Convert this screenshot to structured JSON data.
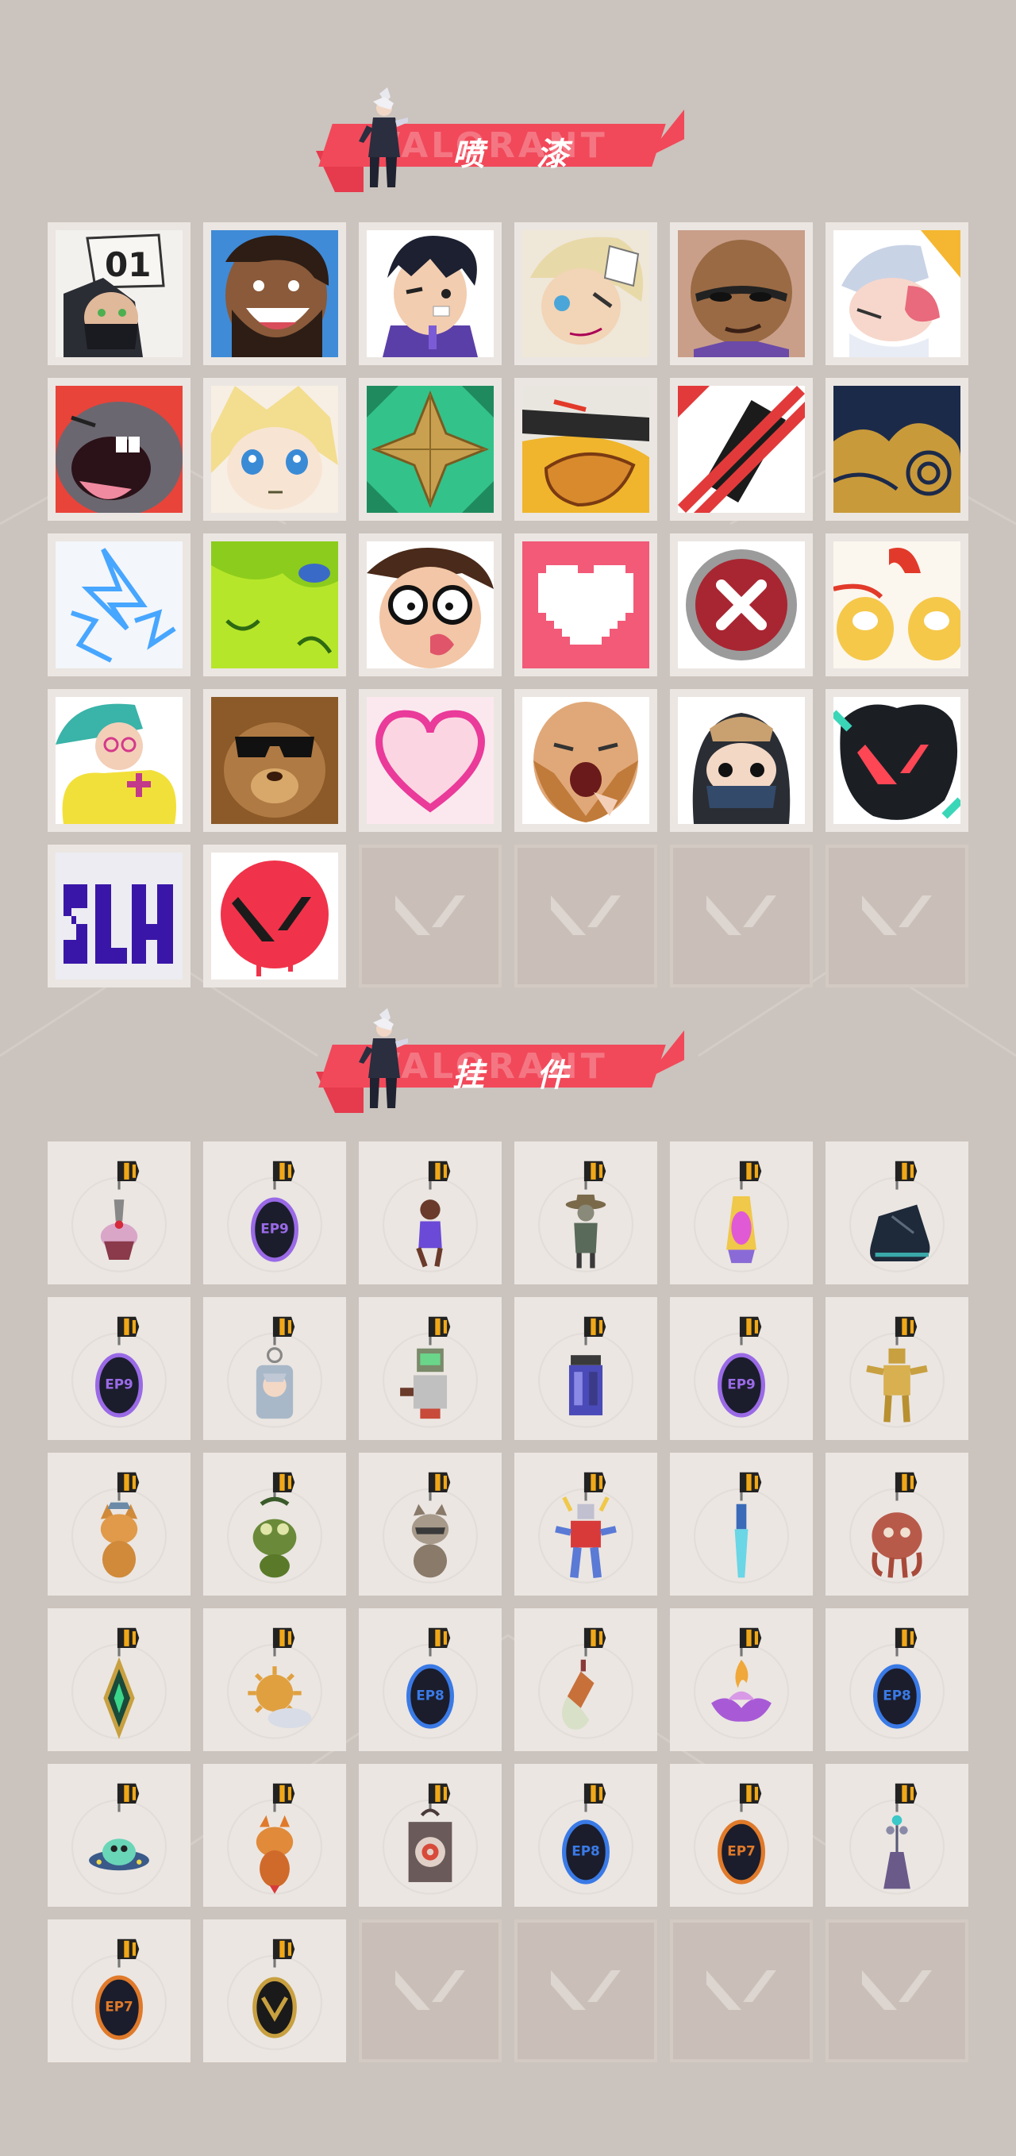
{
  "sections": {
    "sprays": {
      "title": "喷 漆",
      "ghost": "VALORANT"
    },
    "charms": {
      "title": "挂 件",
      "ghost": "VALORANT"
    }
  },
  "colors": {
    "background": "#cbc3bd",
    "banner": "#f1495a",
    "tile": "#ebe6e2",
    "empty_tile": "#c9bfb8"
  },
  "sprays": [
    {
      "icon": "masked-agent-01-spray-icon"
    },
    {
      "icon": "laughing-bearded-agent-spray-icon"
    },
    {
      "icon": "winking-agent-spray-icon"
    },
    {
      "icon": "blond-agent-spray-icon"
    },
    {
      "icon": "smug-agent-spray-icon"
    },
    {
      "icon": "crying-agent-spray-icon"
    },
    {
      "icon": "screaming-creature-spray-icon"
    },
    {
      "icon": "blond-chibi-spray-icon"
    },
    {
      "icon": "gold-star-spray-icon"
    },
    {
      "icon": "duck-bill-spray-icon"
    },
    {
      "icon": "no-spray-can-spray-icon"
    },
    {
      "icon": "golden-clouds-spray-icon"
    },
    {
      "icon": "neon-bolts-spray-icon"
    },
    {
      "icon": "green-slime-spray-icon"
    },
    {
      "icon": "glasses-guy-spray-icon"
    },
    {
      "icon": "pixel-heart-spray-icon"
    },
    {
      "icon": "red-x-button-spray-icon"
    },
    {
      "icon": "lion-dance-spray-icon"
    },
    {
      "icon": "yellow-jacket-agent-spray-icon"
    },
    {
      "icon": "cool-bear-spray-icon"
    },
    {
      "icon": "neon-heart-spray-icon"
    },
    {
      "icon": "yawning-beard-spray-icon"
    },
    {
      "icon": "hooded-chibi-spray-icon"
    },
    {
      "icon": "valorant-v-splash-spray-icon"
    },
    {
      "icon": "graffiti-tag-spray-icon"
    },
    {
      "icon": "red-v-drip-spray-icon"
    },
    {
      "icon": "empty-slot-icon"
    },
    {
      "icon": "empty-slot-icon"
    },
    {
      "icon": "empty-slot-icon"
    },
    {
      "icon": "empty-slot-icon"
    }
  ],
  "charms": [
    {
      "icon": "cupcake-charm-icon"
    },
    {
      "icon": "ep9-medal-charm-icon"
    },
    {
      "icon": "agent-figure-charm-icon"
    },
    {
      "icon": "cowboy-figure-charm-icon"
    },
    {
      "icon": "lava-lamp-charm-icon"
    },
    {
      "icon": "sneaker-charm-icon"
    },
    {
      "icon": "ep9-medal-charm-icon"
    },
    {
      "icon": "chibi-keychain-charm-icon"
    },
    {
      "icon": "robot-charm-icon"
    },
    {
      "icon": "lantern-charm-icon"
    },
    {
      "icon": "ep9-medal-charm-icon"
    },
    {
      "icon": "gold-robot-charm-icon"
    },
    {
      "icon": "fox-charm-icon"
    },
    {
      "icon": "frog-charm-icon"
    },
    {
      "icon": "raccoon-charm-icon"
    },
    {
      "icon": "mech-robot-charm-icon"
    },
    {
      "icon": "blue-blade-charm-icon"
    },
    {
      "icon": "octopus-charm-icon"
    },
    {
      "icon": "green-diamond-charm-icon"
    },
    {
      "icon": "sun-cloud-charm-icon"
    },
    {
      "icon": "ep8-medal-charm-icon"
    },
    {
      "icon": "bottle-charm-icon"
    },
    {
      "icon": "flame-lotus-charm-icon"
    },
    {
      "icon": "ep8-medal-charm-icon"
    },
    {
      "icon": "ufo-charm-icon"
    },
    {
      "icon": "orange-creature-charm-icon"
    },
    {
      "icon": "target-bag-charm-icon"
    },
    {
      "icon": "ep8-medal-charm-icon"
    },
    {
      "icon": "ep7-medal-charm-icon"
    },
    {
      "icon": "tassel-charm-icon"
    },
    {
      "icon": "ep7-medal-charm-icon"
    },
    {
      "icon": "v-badge-charm-icon"
    },
    {
      "icon": "empty-slot-icon"
    },
    {
      "icon": "empty-slot-icon"
    },
    {
      "icon": "empty-slot-icon"
    },
    {
      "icon": "empty-slot-icon"
    }
  ],
  "medal_texts": {
    "ep9": "EP9",
    "ep8": "EP8",
    "ep7": "EP7"
  }
}
